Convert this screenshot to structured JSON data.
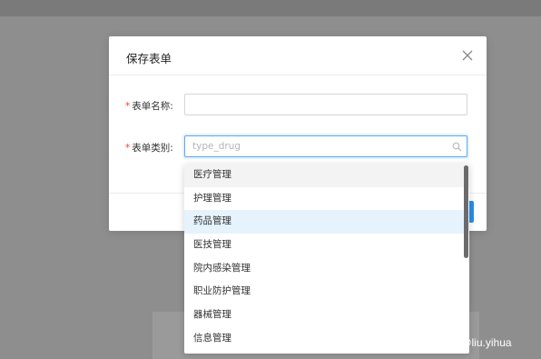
{
  "modal": {
    "title": "保存表单",
    "close_icon": "close-icon",
    "fields": {
      "name": {
        "required_mark": "*",
        "label": "表单名称:",
        "value": "",
        "placeholder": ""
      },
      "category": {
        "required_mark": "*",
        "label": "表单类别:",
        "value": "",
        "placeholder": "type_drug",
        "icon": "search-icon"
      }
    }
  },
  "dropdown": {
    "options": [
      "医疗管理",
      "护理管理",
      "药品管理",
      "医技管理",
      "院内感染管理",
      "职业防护管理",
      "器械管理",
      "信息管理"
    ],
    "hovered_index": 0,
    "selected_index": 2
  },
  "watermark": "CSDN @liu.yihua",
  "colors": {
    "primary": "#2b8de8",
    "required": "#f04134",
    "focus_border": "#5aa9ee",
    "selected_bg": "#e6f3fd"
  }
}
